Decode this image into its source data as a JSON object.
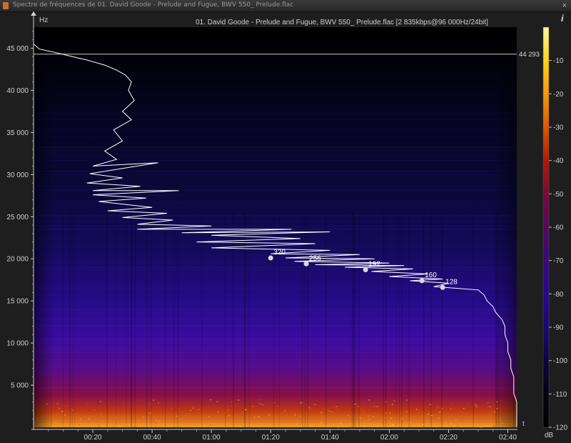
{
  "window": {
    "title": "Spectre de fréquences de 01. David Goode - Prelude and Fugue, BWV 550_ Prelude.flac",
    "close_glyph": "×"
  },
  "header": {
    "y_unit": "Hz",
    "file_info": "01. David Goode - Prelude and Fugue, BWV 550_ Prelude.flac [2 835kbps@96 000Hz/24bit]",
    "info_icon": "i"
  },
  "icons": {
    "info": "info-icon",
    "app": "app-icon",
    "close": "close-icon"
  },
  "axes": {
    "x_unit": "t",
    "x_ticks": [
      "00:20",
      "00:40",
      "01:00",
      "01:20",
      "01:40",
      "02:00",
      "02:20",
      "02:40"
    ],
    "y_ticks": [
      "5 000",
      "10 000",
      "15 000",
      "20 000",
      "25 000",
      "30 000",
      "35 000",
      "40 000",
      "45 000"
    ],
    "freq_max": 47500,
    "duration_seconds": 163
  },
  "cutoff": {
    "label": "44 293",
    "freq": 44293
  },
  "colorbar": {
    "unit": "dB",
    "ticks": [
      "-10",
      "-20",
      "-30",
      "-40",
      "-50",
      "-60",
      "-70",
      "-80",
      "-90",
      "-100",
      "-110",
      "-120"
    ],
    "colors": [
      "#fff6a0",
      "#ffd21a",
      "#f39a10",
      "#d85a06",
      "#b01808",
      "#7a0a38",
      "#520a5e",
      "#38087a",
      "#28088c",
      "#1a0870",
      "#0d0540",
      "#050210",
      "#000000"
    ]
  },
  "markers": [
    {
      "label": "320",
      "t": 80,
      "freq": 20100
    },
    {
      "label": "256",
      "t": 92,
      "freq": 19400
    },
    {
      "label": "192",
      "t": 112,
      "freq": 18700
    },
    {
      "label": "160",
      "t": 131,
      "freq": 17400
    },
    {
      "label": "128",
      "t": 138,
      "freq": 16600
    }
  ],
  "trace": [
    [
      0,
      45500
    ],
    [
      2,
      44900
    ],
    [
      6,
      44600
    ],
    [
      12,
      44100
    ],
    [
      18,
      43600
    ],
    [
      24,
      43000
    ],
    [
      28,
      42400
    ],
    [
      31,
      41800
    ],
    [
      33,
      41000
    ],
    [
      32,
      40000
    ],
    [
      34,
      38800
    ],
    [
      30,
      37500
    ],
    [
      33,
      36500
    ],
    [
      27,
      35300
    ],
    [
      30,
      34000
    ],
    [
      24,
      32800
    ],
    [
      28,
      31800
    ],
    [
      20,
      31000
    ],
    [
      42,
      31400
    ],
    [
      19,
      30100
    ],
    [
      30,
      29600
    ],
    [
      18,
      29000
    ],
    [
      36,
      28600
    ],
    [
      20,
      28100
    ],
    [
      49,
      28100
    ],
    [
      20,
      27600
    ],
    [
      38,
      27200
    ],
    [
      22,
      26800
    ],
    [
      40,
      26100
    ],
    [
      25,
      25700
    ],
    [
      45,
      25400
    ],
    [
      30,
      24900
    ],
    [
      47,
      24600
    ],
    [
      35,
      24100
    ],
    [
      60,
      23900
    ],
    [
      35,
      23500
    ],
    [
      87,
      23500
    ],
    [
      50,
      23100
    ],
    [
      100,
      23200
    ],
    [
      60,
      22800
    ],
    [
      90,
      22400
    ],
    [
      55,
      22000
    ],
    [
      95,
      21800
    ],
    [
      60,
      21300
    ],
    [
      100,
      21000
    ],
    [
      80,
      20600
    ],
    [
      110,
      20500
    ],
    [
      85,
      20100
    ],
    [
      115,
      20000
    ],
    [
      88,
      19700
    ],
    [
      120,
      19500
    ],
    [
      95,
      19300
    ],
    [
      125,
      19200
    ],
    [
      105,
      19000
    ],
    [
      128,
      18800
    ],
    [
      114,
      18500
    ],
    [
      133,
      18200
    ],
    [
      120,
      17900
    ],
    [
      138,
      17600
    ],
    [
      127,
      17400
    ],
    [
      140,
      17100
    ],
    [
      135,
      16700
    ],
    [
      150,
      16300
    ],
    [
      152,
      15700
    ],
    [
      153,
      15000
    ],
    [
      155,
      14300
    ],
    [
      156,
      13600
    ],
    [
      158,
      12800
    ],
    [
      159,
      12000
    ],
    [
      159,
      11000
    ],
    [
      160,
      10000
    ],
    [
      160,
      9000
    ],
    [
      161,
      8000
    ],
    [
      161,
      7000
    ],
    [
      162,
      6000
    ],
    [
      162,
      5000
    ],
    [
      162,
      4000
    ],
    [
      163,
      3000
    ],
    [
      163,
      2000
    ],
    [
      163,
      1000
    ],
    [
      163,
      0
    ]
  ]
}
